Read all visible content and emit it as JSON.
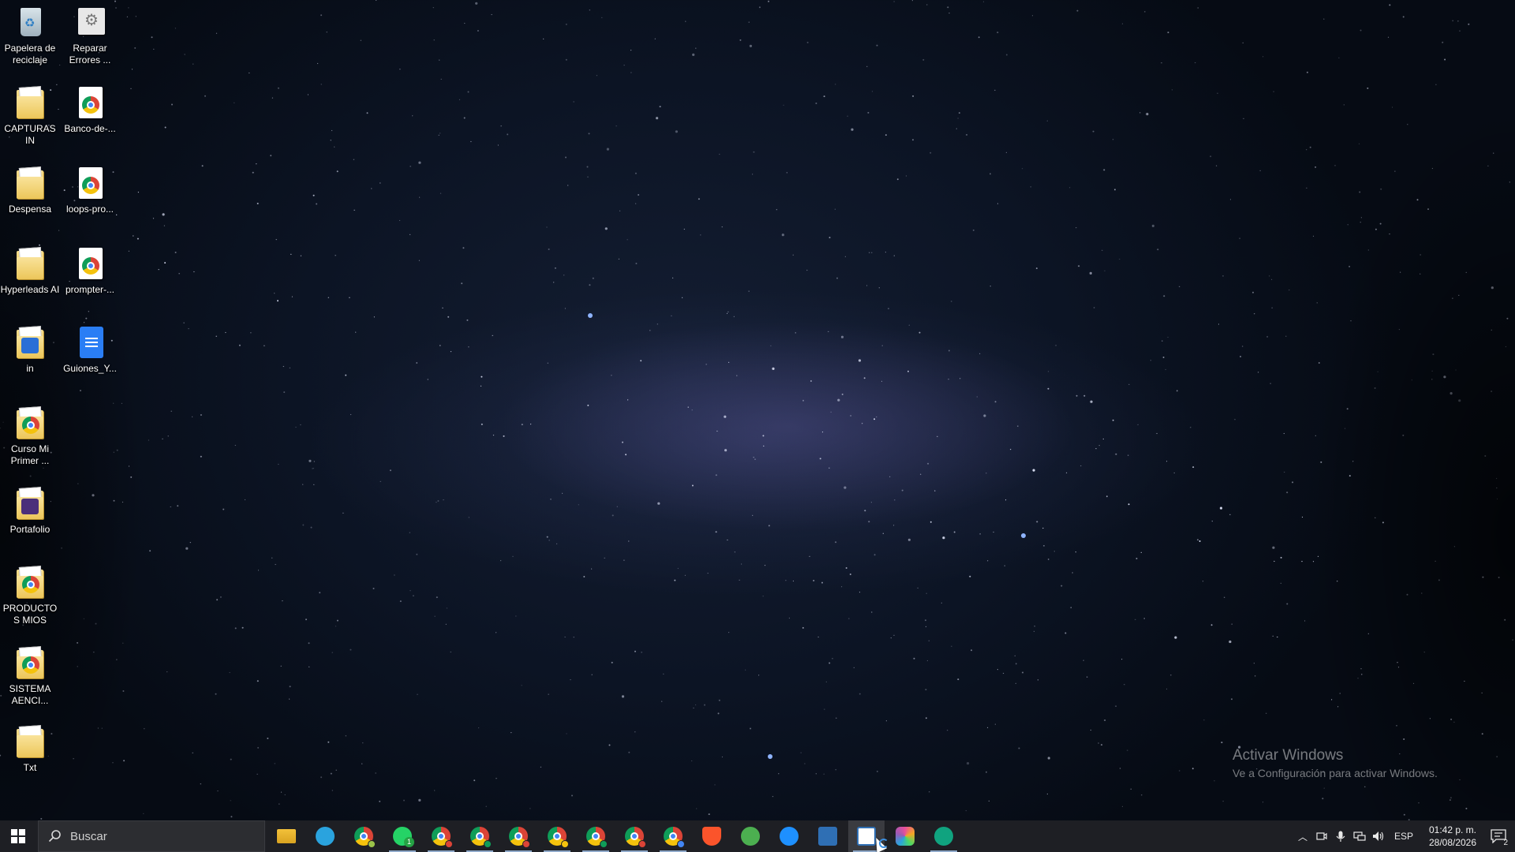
{
  "desktop": {
    "icons": [
      {
        "label": "Papelera de reciclaje",
        "icon": "recycle-bin-icon"
      },
      {
        "label": "Reparar Errores ...",
        "icon": "settings-shortcut-icon"
      },
      {
        "label": "CAPTURAS IN",
        "icon": "folder-icon"
      },
      {
        "label": "Banco-de-...",
        "icon": "chrome-file-icon"
      },
      {
        "label": "Despensa",
        "icon": "folder-icon"
      },
      {
        "label": "loops-pro...",
        "icon": "chrome-file-icon"
      },
      {
        "label": "Hyperleads AI",
        "icon": "folder-icon"
      },
      {
        "label": "prompter-...",
        "icon": "chrome-file-icon"
      },
      {
        "label": "in",
        "icon": "folder-icon"
      },
      {
        "label": "Guiones_Y...",
        "icon": "google-docs-icon"
      },
      {
        "label": "Curso Mi Primer ...",
        "icon": "folder-icon"
      },
      {
        "label": "Portafolio",
        "icon": "folder-icon"
      },
      {
        "label": "PRODUCTOS MIOS",
        "icon": "folder-icon"
      },
      {
        "label": "SISTEMA AENCI...",
        "icon": "folder-icon"
      },
      {
        "label": "Txt",
        "icon": "folder-icon"
      }
    ]
  },
  "watermark": {
    "title": "Activar Windows",
    "subtitle": "Ve a Configuración para activar Windows."
  },
  "taskbar": {
    "search_placeholder": "Buscar",
    "apps": [
      {
        "name": "file-explorer-icon",
        "color": "#f3c13a"
      },
      {
        "name": "telegram-icon",
        "color": "#2aa3de"
      },
      {
        "name": "chrome-profile-icon",
        "color": "#9bc34a"
      },
      {
        "name": "whatsapp-icon",
        "color": "#25d366",
        "badge": "1"
      },
      {
        "name": "chrome-icon",
        "color": "#db4437"
      },
      {
        "name": "chrome-icon",
        "color": "#0f9d58"
      },
      {
        "name": "chrome-icon",
        "color": "#db4437"
      },
      {
        "name": "chrome-icon",
        "color": "#f4c20d"
      },
      {
        "name": "chrome-icon",
        "color": "#0f9d58"
      },
      {
        "name": "chrome-icon",
        "color": "#db4437"
      },
      {
        "name": "chrome-icon",
        "color": "#4285f4"
      },
      {
        "name": "brave-icon",
        "color": "#fb542b"
      },
      {
        "name": "y-app-icon",
        "color": "#4caf50"
      },
      {
        "name": "feather-app-icon",
        "color": "#1e90ff"
      },
      {
        "name": "calculator-icon",
        "color": "#2f6fb4"
      },
      {
        "name": "blue-app-icon",
        "color": "#ffffff"
      },
      {
        "name": "colorful-app-icon",
        "color": "#e94f9b"
      },
      {
        "name": "chatgpt-icon",
        "color": "#10a37f"
      }
    ],
    "tray": {
      "language": "ESP",
      "time": "01:42 p. m.",
      "date": "28/08/2026",
      "notifications": "2"
    }
  }
}
